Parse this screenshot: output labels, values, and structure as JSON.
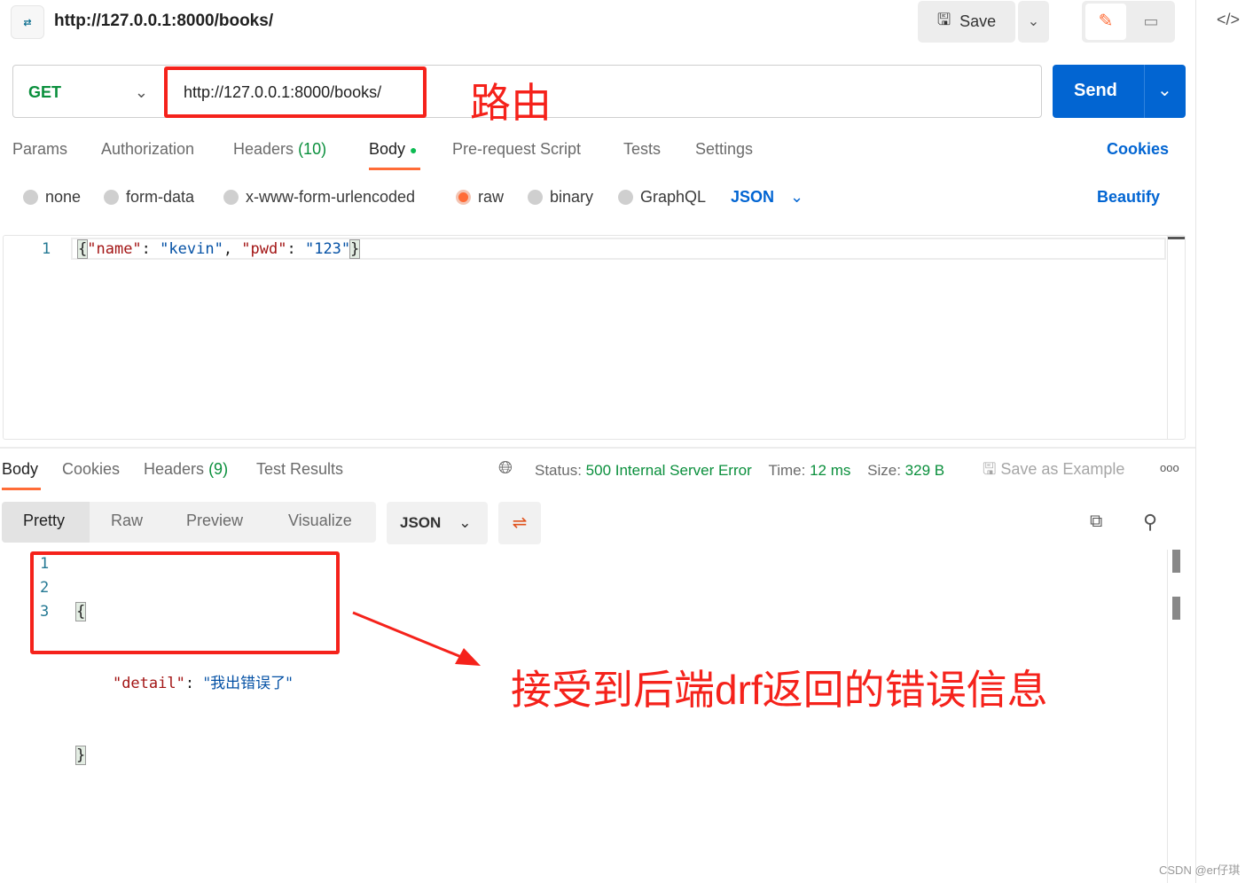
{
  "header": {
    "title": "http://127.0.0.1:8000/books/",
    "save_label": "Save"
  },
  "request": {
    "method": "GET",
    "url": "http://127.0.0.1:8000/books/",
    "send_label": "Send"
  },
  "request_tabs": [
    {
      "label": "Params"
    },
    {
      "label": "Authorization"
    },
    {
      "label": "Headers",
      "count": "(10)"
    },
    {
      "label": "Body"
    },
    {
      "label": "Pre-request Script"
    },
    {
      "label": "Tests"
    },
    {
      "label": "Settings"
    }
  ],
  "cookies_label": "Cookies",
  "body_types": [
    "none",
    "form-data",
    "x-www-form-urlencoded",
    "raw",
    "binary",
    "GraphQL"
  ],
  "body_format": "JSON",
  "beautify_label": "Beautify",
  "request_body": {
    "line": "1",
    "open": "{",
    "k1": "\"name\"",
    "v1": "\"kevin\"",
    "k2": "\"pwd\"",
    "v2": "\"123\"",
    "close": "}"
  },
  "response_tabs": [
    {
      "label": "Body"
    },
    {
      "label": "Cookies"
    },
    {
      "label": "Headers",
      "count": "(9)"
    },
    {
      "label": "Test Results"
    }
  ],
  "status": {
    "status_label": "Status:",
    "status_value": "500 Internal Server Error",
    "time_label": "Time:",
    "time_value": "12 ms",
    "size_label": "Size:",
    "size_value": "329 B",
    "save_example": "Save as Example"
  },
  "view_modes": [
    "Pretty",
    "Raw",
    "Preview",
    "Visualize"
  ],
  "response_format": "JSON",
  "response_body": {
    "lines": [
      "1",
      "2",
      "3"
    ],
    "open": "{",
    "key": "\"detail\"",
    "value": "\"我出错误了\"",
    "close": "}"
  },
  "annotations": {
    "route": "路由",
    "error_note": "接受到后端drf返回的错误信息"
  },
  "watermark": "CSDN @er仔琪",
  "colors": {
    "accent": "#ff6c37",
    "send": "#0265d2",
    "green": "#0a8f3c",
    "annotation": "#f5221b"
  }
}
